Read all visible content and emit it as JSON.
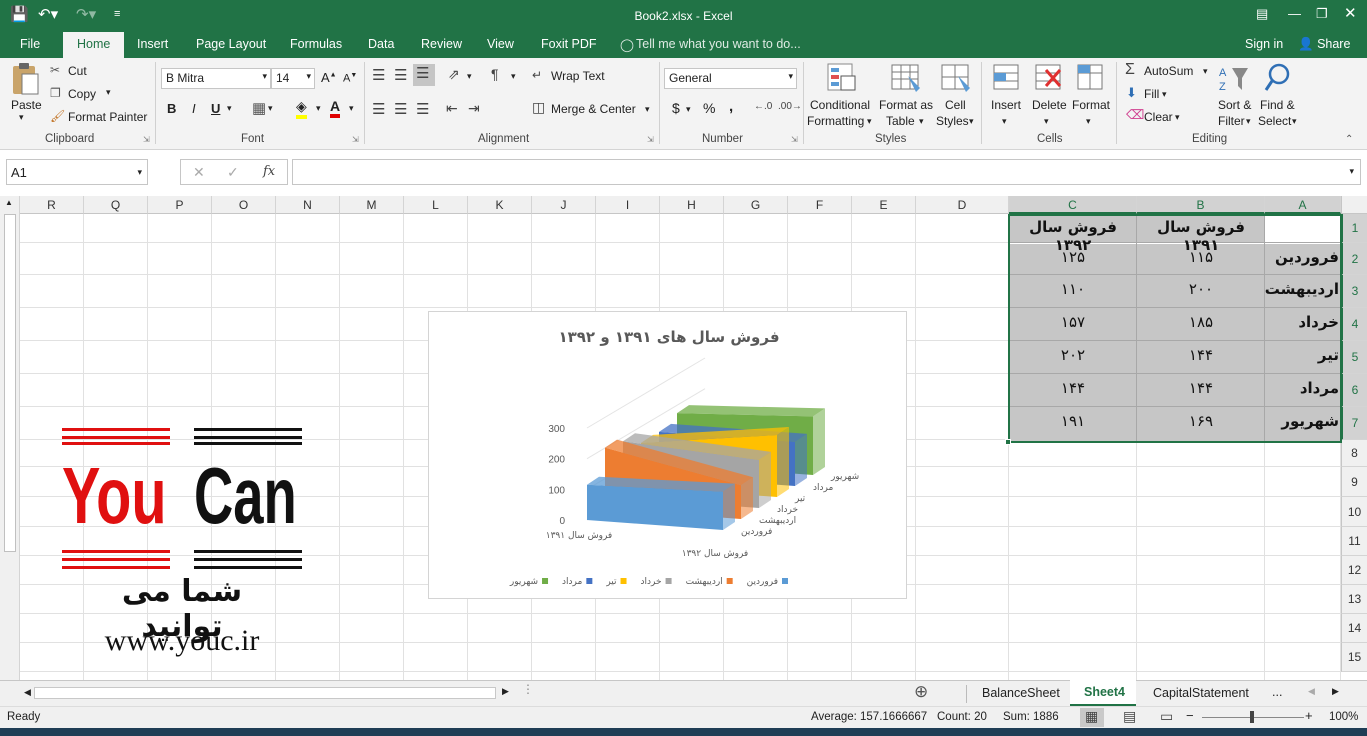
{
  "window": {
    "title": "Book2.xlsx - Excel"
  },
  "menu": {
    "tabs": [
      "File",
      "Home",
      "Insert",
      "Page Layout",
      "Formulas",
      "Data",
      "Review",
      "View",
      "Foxit PDF"
    ],
    "tell_me": "Tell me what you want to do...",
    "sign_in": "Sign in",
    "share": "Share"
  },
  "ribbon": {
    "clipboard": {
      "label": "Clipboard",
      "paste": "Paste",
      "cut": "Cut",
      "copy": "Copy",
      "format_painter": "Format Painter"
    },
    "font": {
      "label": "Font",
      "font_name": "B Mitra",
      "font_size": "14",
      "bold": "B",
      "italic": "I",
      "underline": "U"
    },
    "alignment": {
      "label": "Alignment",
      "wrap_text": "Wrap Text",
      "merge_center": "Merge & Center"
    },
    "number": {
      "label": "Number",
      "format": "General",
      "currency": "$",
      "percent": "%",
      "comma": ","
    },
    "styles": {
      "label": "Styles",
      "conditional": "Conditional",
      "formatting": "Formatting",
      "format_as": "Format as",
      "table": "Table",
      "cell": "Cell",
      "cell_styles": "Styles"
    },
    "cells": {
      "label": "Cells",
      "insert": "Insert",
      "delete": "Delete",
      "format": "Format"
    },
    "editing": {
      "label": "Editing",
      "autosum": "AutoSum",
      "fill": "Fill",
      "clear": "Clear",
      "sort": "Sort &",
      "filter": "Filter",
      "find": "Find &",
      "select": "Select"
    }
  },
  "formula_bar": {
    "name_box": "A1",
    "fx": "fx",
    "formula": ""
  },
  "columns": [
    "R",
    "Q",
    "P",
    "O",
    "N",
    "M",
    "L",
    "K",
    "J",
    "I",
    "H",
    "G",
    "F",
    "E",
    "D",
    "C",
    "B",
    "A"
  ],
  "rows": [
    "1",
    "2",
    "3",
    "4",
    "5",
    "6",
    "7",
    "8",
    "9",
    "10",
    "11",
    "12",
    "13",
    "14",
    "15"
  ],
  "table": {
    "header_b": "فروش سال ۱۳۹۱",
    "header_c": "فروش سال ۱۳۹۲",
    "rows": [
      {
        "month": "فروردین",
        "b": "۱۱۵",
        "c": "۱۲۵"
      },
      {
        "month": "اردیبهشت",
        "b": "۲۰۰",
        "c": "۱۱۰"
      },
      {
        "month": "خرداد",
        "b": "۱۸۵",
        "c": "۱۵۷"
      },
      {
        "month": "تیر",
        "b": "۱۴۴",
        "c": "۲۰۲"
      },
      {
        "month": "مرداد",
        "b": "۱۴۴",
        "c": "۱۴۴"
      },
      {
        "month": "شهریور",
        "b": "۱۶۹",
        "c": "۱۹۱"
      }
    ]
  },
  "chart_data": {
    "type": "bar",
    "title": "فروش سال های ۱۳۹۱ و ۱۳۹۲",
    "categories": [
      "فروش سال ۱۳۹۱",
      "فروش سال ۱۳۹۲"
    ],
    "series": [
      {
        "name": "فروردین",
        "values": [
          115,
          125
        ],
        "color": "#5b9bd5"
      },
      {
        "name": "اردیبهشت",
        "values": [
          200,
          110
        ],
        "color": "#ed7d31"
      },
      {
        "name": "خرداد",
        "values": [
          185,
          157
        ],
        "color": "#a5a5a5"
      },
      {
        "name": "تیر",
        "values": [
          144,
          202
        ],
        "color": "#ffc000"
      },
      {
        "name": "مرداد",
        "values": [
          144,
          144
        ],
        "color": "#4472c4"
      },
      {
        "name": "شهریور",
        "values": [
          169,
          191
        ],
        "color": "#70ad47"
      }
    ],
    "yticks": [
      "0",
      "100",
      "200",
      "300"
    ],
    "ylim": [
      0,
      300
    ],
    "legend": "bottom"
  },
  "logo": {
    "word1": "You",
    "word2": "Can",
    "tagline": "شما می توانید",
    "url": "www.youc.ir"
  },
  "sheets": {
    "tabs": [
      "BalanceSheet",
      "Sheet4",
      "CapitalStatement"
    ],
    "more": "..."
  },
  "status": {
    "ready": "Ready",
    "average": "Average: 157.1666667",
    "count": "Count: 20",
    "sum": "Sum: 1886",
    "zoom": "100%"
  },
  "colors": {
    "excel_green": "#217346",
    "selection_fill": "#c6c6c6"
  }
}
